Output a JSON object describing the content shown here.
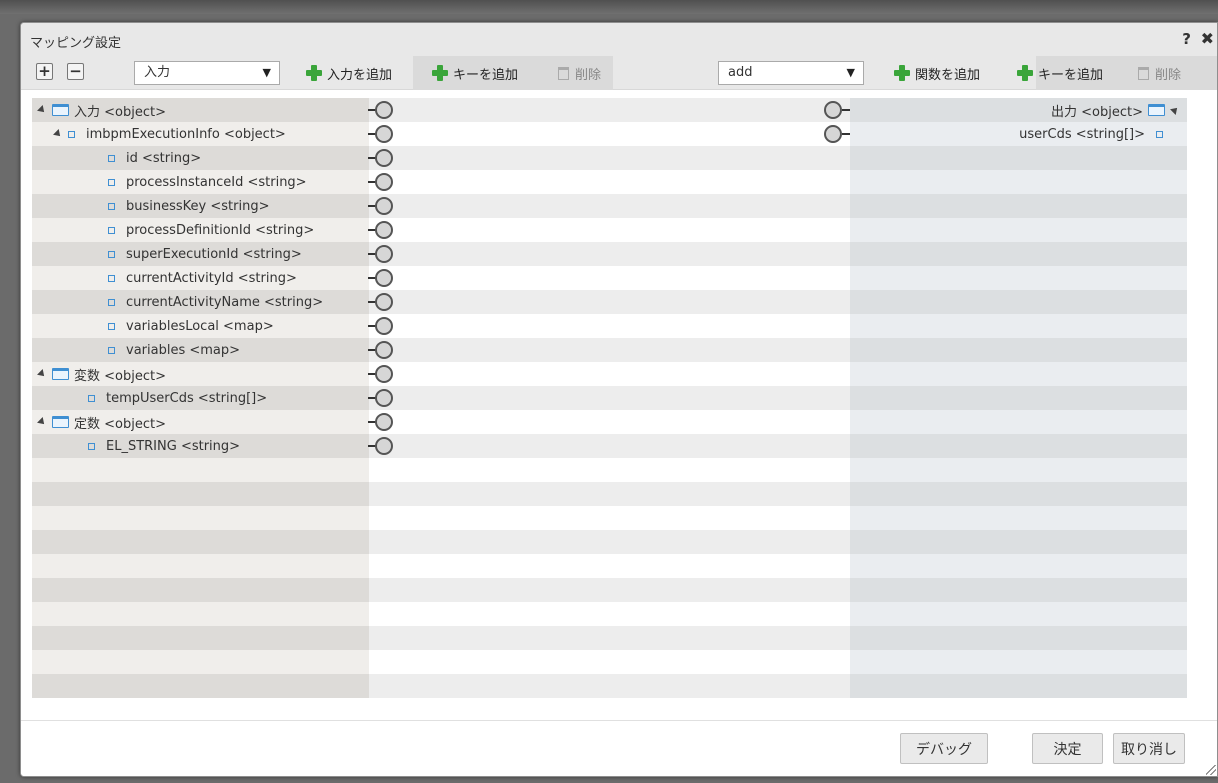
{
  "dialog": {
    "title": "マッピング設定",
    "help_label": "?",
    "close_label": "✖"
  },
  "toolbar": {
    "expand_label": "+",
    "collapse_label": "−",
    "source_select": {
      "value": "入力",
      "caret": "▼"
    },
    "add_input_label": "入力を追加",
    "add_key_left_label": "キーを追加",
    "delete_left_label": "削除",
    "function_select": {
      "value": "add",
      "caret": "▼"
    },
    "add_function_label": "関数を追加",
    "add_key_right_label": "キーを追加",
    "delete_right_label": "削除"
  },
  "source_tree": [
    {
      "label": "入力 <object>",
      "type": "folder",
      "expandable": true
    },
    {
      "label": "imbpmExecutionInfo <object>",
      "type": "node",
      "expandable": true
    },
    {
      "label": "id <string>",
      "type": "leaf"
    },
    {
      "label": "processInstanceId <string>",
      "type": "leaf"
    },
    {
      "label": "businessKey <string>",
      "type": "leaf"
    },
    {
      "label": "processDefinitionId <string>",
      "type": "leaf"
    },
    {
      "label": "superExecutionId <string>",
      "type": "leaf"
    },
    {
      "label": "currentActivityId <string>",
      "type": "leaf"
    },
    {
      "label": "currentActivityName <string>",
      "type": "leaf"
    },
    {
      "label": "variablesLocal <map>",
      "type": "leaf"
    },
    {
      "label": "variables <map>",
      "type": "leaf"
    },
    {
      "label": "変数 <object>",
      "type": "folder",
      "expandable": true
    },
    {
      "label": "tempUserCds <string[]>",
      "type": "leaf"
    },
    {
      "label": "定数 <object>",
      "type": "folder",
      "expandable": true
    },
    {
      "label": "EL_STRING <string>",
      "type": "leaf"
    }
  ],
  "target_tree": [
    {
      "label": "出力 <object>",
      "type": "folder",
      "expandable": true
    },
    {
      "label": "userCds <string[]>",
      "type": "leaf"
    }
  ],
  "footer": {
    "debug_label": "デバッグ",
    "ok_label": "決定",
    "cancel_label": "取り消し"
  }
}
